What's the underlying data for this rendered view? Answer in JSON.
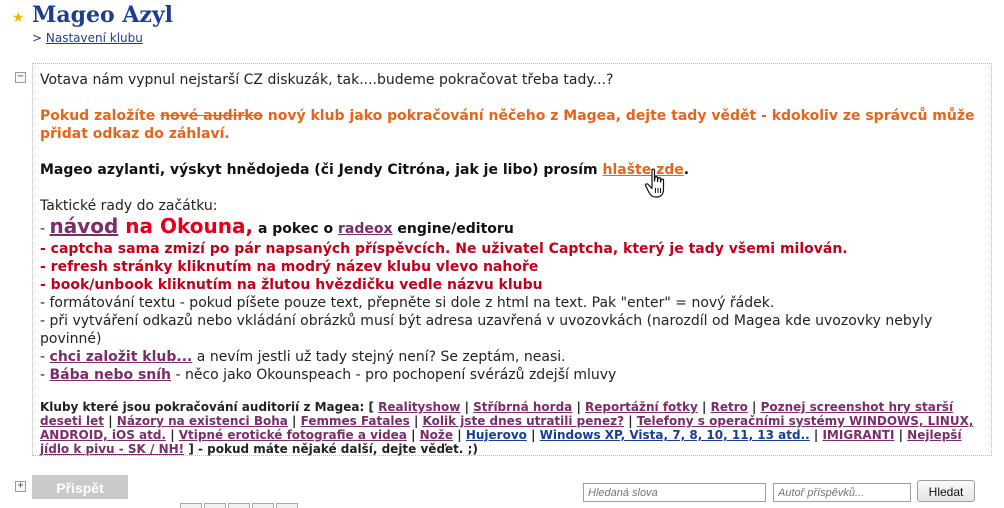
{
  "header": {
    "title": "Mageo Azyl",
    "breadcrumb_prefix": ">",
    "breadcrumb_link": "Nastavení klubu"
  },
  "intro": "Votava nám vypnul nejstarší CZ diskuzák, tak....budeme pokračovat třeba tady...?",
  "notice": {
    "pre": "Pokud založíte ",
    "struck": "nové audirko",
    "post": " nový klub jako pokračování něčeho z Magea, dejte tady vědět - kdokoliv ze správců může přidat odkaz do záhlaví."
  },
  "report": {
    "text": "Mageo azylanti, výskyt hnědojeda (či Jendy Citróna, jak je libo) prosím ",
    "link": "hlašte zde",
    "end": "."
  },
  "tips": {
    "heading": "Taktické rady do začátku:",
    "line1_dash": "- ",
    "line1_link": "návod",
    "line1_red": " na Okouna,",
    "line1_mid": " a pokec o ",
    "line1_link2": "radeox",
    "line1_end": " engine/editoru",
    "line2": "- captcha sama zmizí po pár napsaných příspěvcích. Ne uživatel Captcha, který je tady všemi milován.",
    "line3": "- refresh stránky kliknutím na modrý název klubu vlevo nahoře",
    "line4": "- book/unbook kliknutím na žlutou hvězdičku vedle názvu klubu",
    "line5": "- formátování textu - pokud píšete pouze text, přepněte si dole z html na text. Pak \"enter\" = nový řádek.",
    "line6": "- při vytváření odkazů nebo vkládání obrázků musí být adresa uzavřená v uvozovkách (narozdíl od Magea kde uvozovky nebyly povinné)",
    "line7_dash": "- ",
    "line7_link": "chci založit klub...",
    "line7_text": " a nevím jestli už tady stejný není? Se zeptám, neasi.",
    "line8_dash": "- ",
    "line8_link": "Bába nebo sníh",
    "line8_text": " - něco jako Okounspeach - pro pochopení svérázů zdejší mluvy"
  },
  "clubs": {
    "intro": "Kluby které jsou pokračování auditorií z Magea: [ ",
    "items": [
      "Realityshow",
      "Stříbrná horda",
      "Reportážní fotky",
      "Retro",
      "Poznej screenshot hry starší deseti let",
      "Názory na existenci Boha",
      "Femmes Fatales",
      "Kolik jste dnes utratili penez?",
      "Telefony s operačními systémy WINDOWS, LINUX, ANDROID, iOS atd.",
      "Vtipné erotické fotografie a videa",
      "Nože",
      "Hujerovo",
      "Windows XP, Vista, 7, 8, 10, 11, 13 atd..",
      "IMIGRANTI",
      "Nejlepší jídlo k pivu - SK / NH!"
    ],
    "separator": " | ",
    "outro": " ] - pokud máte nějaké další, dejte věďet. ;)"
  },
  "footer": {
    "post_button": "Přispět",
    "search_placeholder": "Hledaná slova",
    "author_placeholder": "Autoř příspěvků...",
    "search_button": "Hledat"
  },
  "icons": {
    "star": "star-icon",
    "collapse": "minus-box-icon",
    "expand": "plus-box-icon",
    "cursor": "hand-pointer-icon"
  },
  "colors": {
    "title_blue": "#1b3d92",
    "orange": "#e8641a",
    "red": "#c4001a",
    "purple": "#7b2d6b",
    "star": "#f3b400"
  }
}
